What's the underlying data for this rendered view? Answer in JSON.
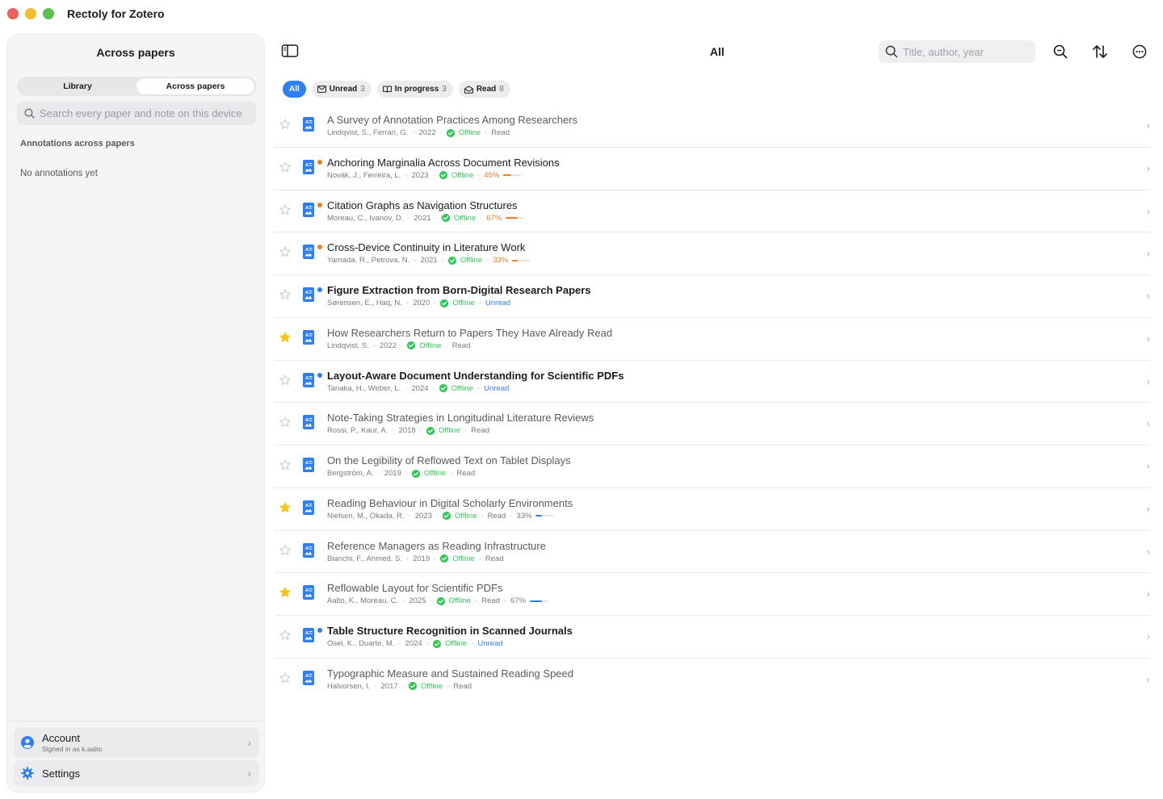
{
  "window": {
    "title": "Rectoly for Zotero"
  },
  "sidebar": {
    "title": "Across papers",
    "segments": [
      {
        "label": "Library",
        "active": false
      },
      {
        "label": "Across papers",
        "active": true
      }
    ],
    "search_placeholder": "Search every paper and note on this device",
    "section_title": "Annotations across papers",
    "empty_text": "No annotations yet",
    "account": {
      "label": "Account",
      "sub": "Signed in as k.aalto",
      "icon": "person-circle-icon"
    },
    "settings": {
      "label": "Settings",
      "icon": "gear-icon"
    }
  },
  "toolbar": {
    "title": "All",
    "search_placeholder": "Title, author, year",
    "icons": [
      "sidebar-toggle-icon",
      "zoom-search-icon",
      "sort-icon",
      "more-icon"
    ]
  },
  "filters": [
    {
      "label": "All",
      "count": "",
      "active": true,
      "icon": ""
    },
    {
      "label": "Unread",
      "count": "3",
      "active": false,
      "icon": "envelope-icon"
    },
    {
      "label": "In progress",
      "count": "3",
      "active": false,
      "icon": "book-icon"
    },
    {
      "label": "Read",
      "count": "8",
      "active": false,
      "icon": "open-envelope-icon"
    }
  ],
  "colors": {
    "accent": "#2d7ff9",
    "offline": "#34c759",
    "in_progress": "#f07d28",
    "star": "#f5c518"
  },
  "papers": [
    {
      "title": "A Survey of Annotation Practices Among Researchers",
      "authors": "Lindqvist, S., Ferrari, G.",
      "year": "2022",
      "availability": "Offline",
      "status": "Read",
      "progress": "",
      "starred": false,
      "indicator": "none"
    },
    {
      "title": "Anchoring Marginalia Across Document Revisions",
      "authors": "Novák, J., Ferreira, L.",
      "year": "2023",
      "availability": "Offline",
      "status": "",
      "progress": "45%",
      "starred": false,
      "indicator": "orange"
    },
    {
      "title": "Citation Graphs as Navigation Structures",
      "authors": "Moreau, C., Ivanov, D.",
      "year": "2021",
      "availability": "Offline",
      "status": "",
      "progress": "67%",
      "starred": false,
      "indicator": "orange"
    },
    {
      "title": "Cross-Device Continuity in Literature Work",
      "authors": "Yamada, R., Petrova, N.",
      "year": "2021",
      "availability": "Offline",
      "status": "",
      "progress": "33%",
      "starred": false,
      "indicator": "orange"
    },
    {
      "title": "Figure Extraction from Born-Digital Research Papers",
      "authors": "Sørensen, E., Haq, N.",
      "year": "2020",
      "availability": "Offline",
      "status": "Unread",
      "progress": "",
      "starred": false,
      "indicator": "blue"
    },
    {
      "title": "How Researchers Return to Papers They Have Already Read",
      "authors": "Lindqvist, S.",
      "year": "2022",
      "availability": "Offline",
      "status": "Read",
      "progress": "",
      "starred": true,
      "indicator": "none"
    },
    {
      "title": "Layout-Aware Document Understanding for Scientific PDFs",
      "authors": "Tanaka, H., Weber, L.",
      "year": "2024",
      "availability": "Offline",
      "status": "Unread",
      "progress": "",
      "starred": false,
      "indicator": "blue"
    },
    {
      "title": "Note-Taking Strategies in Longitudinal Literature Reviews",
      "authors": "Rossi, P., Kaur, A.",
      "year": "2018",
      "availability": "Offline",
      "status": "Read",
      "progress": "",
      "starred": false,
      "indicator": "none"
    },
    {
      "title": "On the Legibility of Reflowed Text on Tablet Displays",
      "authors": "Bergström, A.",
      "year": "2019",
      "availability": "Offline",
      "status": "Read",
      "progress": "",
      "starred": false,
      "indicator": "none"
    },
    {
      "title": "Reading Behaviour in Digital Scholarly Environments",
      "authors": "Nielsen, M., Okada, R.",
      "year": "2023",
      "availability": "Offline",
      "status": "Read",
      "progress": "33%",
      "starred": true,
      "indicator": "none"
    },
    {
      "title": "Reference Managers as Reading Infrastructure",
      "authors": "Bianchi, F., Ahmed, S.",
      "year": "2019",
      "availability": "Offline",
      "status": "Read",
      "progress": "",
      "starred": false,
      "indicator": "none"
    },
    {
      "title": "Reflowable Layout for Scientific PDFs",
      "authors": "Aalto, K., Moreau, C.",
      "year": "2025",
      "availability": "Offline",
      "status": "Read",
      "progress": "67%",
      "starred": true,
      "indicator": "none"
    },
    {
      "title": "Table Structure Recognition in Scanned Journals",
      "authors": "Osei, K., Duarte, M.",
      "year": "2024",
      "availability": "Offline",
      "status": "Unread",
      "progress": "",
      "starred": false,
      "indicator": "blue"
    },
    {
      "title": "Typographic Measure and Sustained Reading Speed",
      "authors": "Halvorsen, I.",
      "year": "2017",
      "availability": "Offline",
      "status": "Read",
      "progress": "",
      "starred": false,
      "indicator": "none"
    }
  ]
}
